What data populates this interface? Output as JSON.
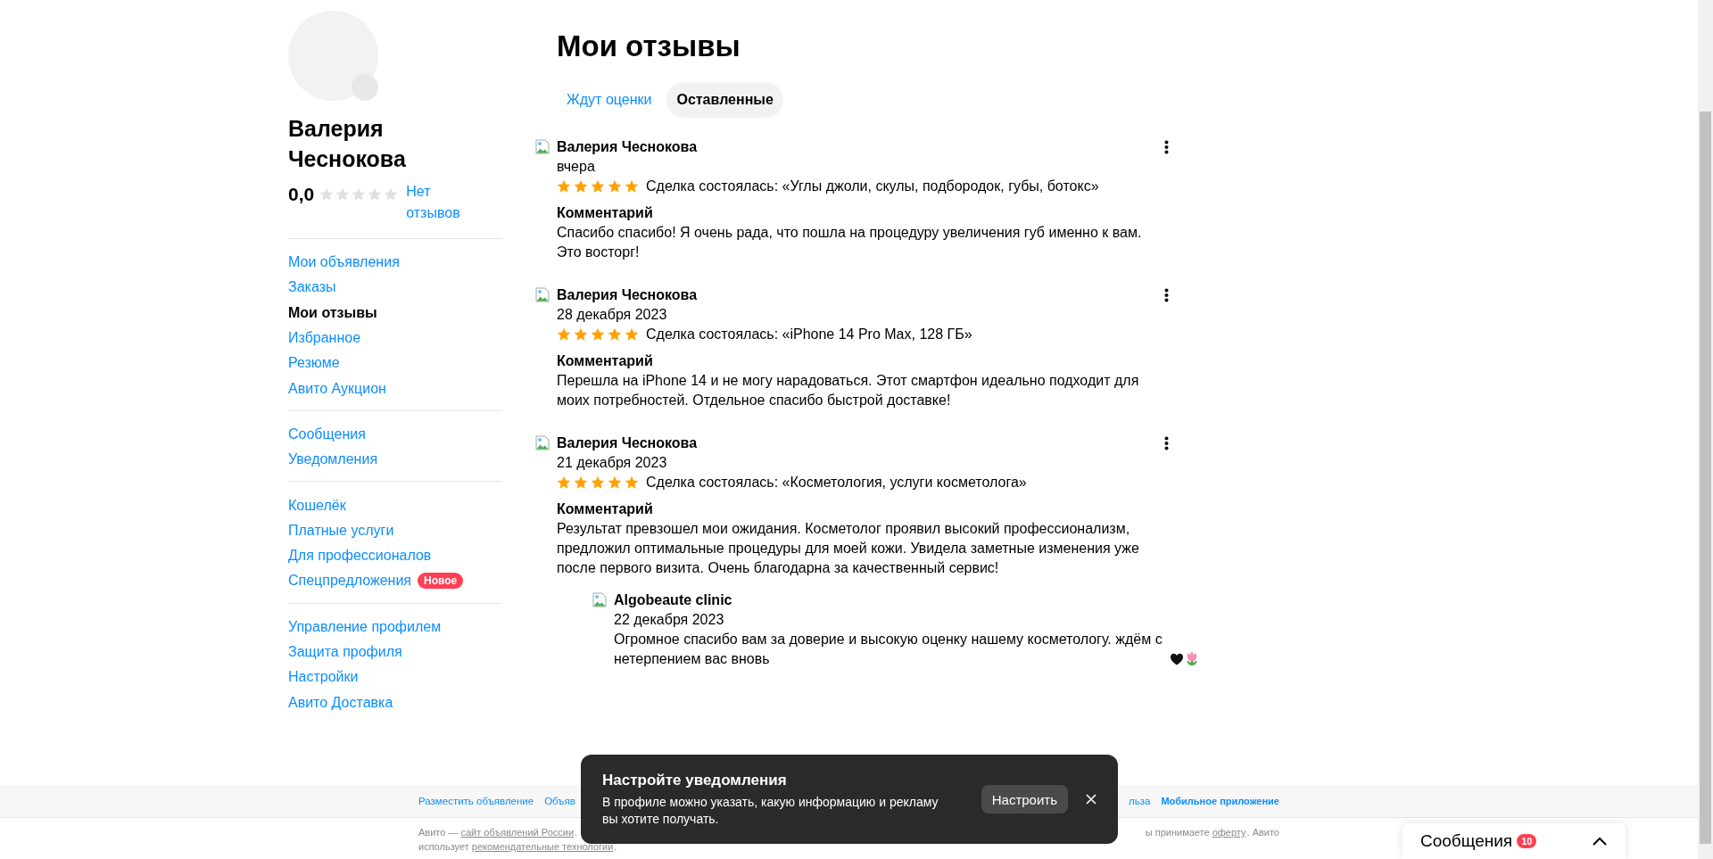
{
  "profile": {
    "name": "Валерия Чеснокова",
    "rating": "0,0",
    "stars": 0,
    "reviews_link": "Нет отзывов"
  },
  "sidebar": {
    "groups": [
      {
        "items": [
          {
            "label": "Мои объявления",
            "selected": false
          },
          {
            "label": "Заказы",
            "selected": false
          },
          {
            "label": "Мои отзывы",
            "selected": true
          },
          {
            "label": "Избранное",
            "selected": false
          },
          {
            "label": "Резюме",
            "selected": false
          },
          {
            "label": "Авито Аукцион",
            "selected": false
          }
        ]
      },
      {
        "items": [
          {
            "label": "Сообщения",
            "selected": false
          },
          {
            "label": "Уведомления",
            "selected": false
          }
        ]
      },
      {
        "items": [
          {
            "label": "Кошелёк",
            "selected": false
          },
          {
            "label": "Платные услуги",
            "selected": false
          },
          {
            "label": "Для профессионалов",
            "selected": false
          },
          {
            "label": "Спецпредложения",
            "selected": false,
            "badge": "Новое"
          }
        ]
      },
      {
        "items": [
          {
            "label": "Управление профилем",
            "selected": false
          },
          {
            "label": "Защита профиля",
            "selected": false
          },
          {
            "label": "Настройки",
            "selected": false
          },
          {
            "label": "Авито Доставка",
            "selected": false
          }
        ]
      }
    ]
  },
  "page_title": "Мои отзывы",
  "tabs": [
    {
      "label": "Ждут оценки",
      "selected": false
    },
    {
      "label": "Оставленные",
      "selected": true
    }
  ],
  "reviews": [
    {
      "author": "Валерия Чеснокова",
      "date": "вчера",
      "stars": 5,
      "deal": "Сделка состоялась: «Углы джоли, скулы, подбородок, губы, ботокс»",
      "comment_label": "Комментарий",
      "comment": "Спасибо спасибо! Я очень рада, что пошла на процедуру увеличения губ именно к вам. Это восторг!"
    },
    {
      "author": "Валерия Чеснокова",
      "date": "28 декабря 2023",
      "stars": 5,
      "deal": "Сделка состоялась: «iPhone 14 Pro Max, 128 ГБ»",
      "comment_label": "Комментарий",
      "comment": "Перешла на iPhone 14 и не могу нарадоваться. Этот смартфон идеально подходит для моих потребностей. Отдельное спасибо быстрой доставке!"
    },
    {
      "author": "Валерия Чеснокова",
      "date": "21 декабря 2023",
      "stars": 5,
      "deal": "Сделка состоялась: «Косметология, услуги косметолога»",
      "comment_label": "Комментарий",
      "comment": "Результат превзошел мои ожидания. Косметолог проявил высокий профессионализм, предложил оптимальные процедуры для моей кожи. Увидела заметные изменения уже после первого визита. Очень благодарна за качественный сервис!",
      "reply": {
        "author": "Algobeaute clinic",
        "date": "22 декабря 2023",
        "text": "Огромное спасибо вам за доверие и высокую оценку нашему косметологу. ждём с нетерпением вас вновь"
      }
    }
  ],
  "footer": {
    "links_left": [
      {
        "label": "Разместить объявление",
        "bold": false
      },
      {
        "label": "Объяв",
        "bold": false
      }
    ],
    "links_right": [
      {
        "label": "льза",
        "bold": false
      },
      {
        "label": "Мобильное приложение",
        "bold": true
      }
    ],
    "legal_left": [
      {
        "text": "Авито — "
      },
      {
        "text": "сайт объявлений России",
        "link": true
      },
      {
        "text": "."
      }
    ],
    "legal_right": [
      {
        "text": "ы принимаете "
      },
      {
        "text": "оферту",
        "link": true
      },
      {
        "text": ". Авито"
      }
    ],
    "legal_line2": [
      {
        "text": "использует "
      },
      {
        "text": "рекомендательные технологии",
        "link": true
      },
      {
        "text": "."
      }
    ]
  },
  "toast": {
    "title": "Настройте уведомления",
    "text": "В профиле можно указать, какую информацию и рекламу вы хотите получать.",
    "button": "Настроить"
  },
  "messages_widget": {
    "label": "Сообщения",
    "count": "10"
  }
}
